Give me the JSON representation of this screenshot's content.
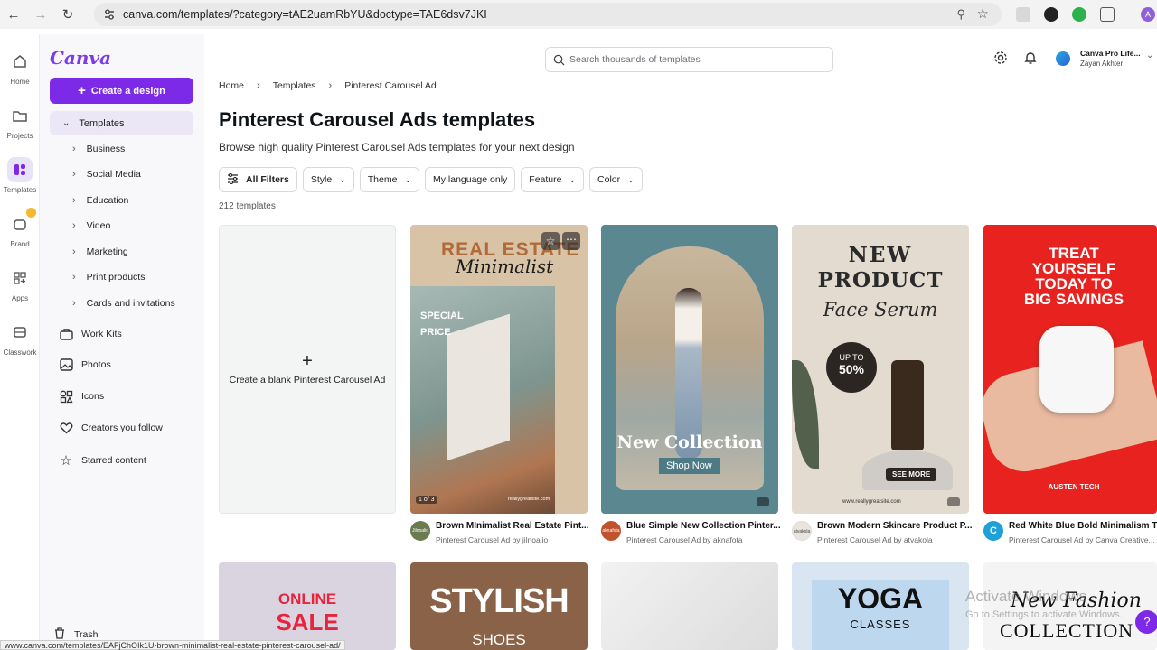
{
  "browser": {
    "url": "canva.com/templates/?category=tAE2uamRbYU&doctype=TAE6dsv7JKI",
    "profile_initial": "A",
    "status_url": "www.canva.com/templates/EAFjChOIk1U-brown-minimalist-real-estate-pinterest-carousel-ad/"
  },
  "rail": [
    {
      "label": "Home"
    },
    {
      "label": "Projects"
    },
    {
      "label": "Templates"
    },
    {
      "label": "Brand"
    },
    {
      "label": "Apps"
    },
    {
      "label": "Classwork"
    }
  ],
  "sidebar": {
    "logo": "Canva",
    "create_label": "Create a design",
    "templates_label": "Templates",
    "sub_items": [
      "Business",
      "Social Media",
      "Education",
      "Video",
      "Marketing",
      "Print products",
      "Cards and invitations"
    ],
    "main_items": [
      "Work Kits",
      "Photos",
      "Icons",
      "Creators you follow",
      "Starred content"
    ],
    "trash_label": "Trash"
  },
  "header": {
    "search_placeholder": "Search thousands of templates",
    "account_name": "Canva Pro Life...",
    "account_user": "Zayan Akhter"
  },
  "breadcrumb": [
    "Home",
    "Templates",
    "Pinterest Carousel Ad"
  ],
  "page": {
    "title": "Pinterest Carousel Ads templates",
    "subtitle": "Browse high quality Pinterest Carousel Ads templates for your next design",
    "count": "212 templates"
  },
  "filters": [
    "All Filters",
    "Style",
    "Theme",
    "My language only",
    "Feature",
    "Color"
  ],
  "blank_card": {
    "label": "Create a blank Pinterest Carousel Ad"
  },
  "templates": [
    {
      "name": "Brown MInimalist Real Estate Pint...",
      "byline": "Pinterest Carousel Ad by jilnoalio",
      "avatar_color": "#6b7a4f",
      "avatar_text": "Jilnoalio",
      "lines": [
        "REAL ESTATE",
        "Minimalist",
        "SPECIAL",
        "PRICE"
      ],
      "pager": "1 of 3",
      "footer_text": "reallygreatsite.com"
    },
    {
      "name": "Blue Simple New Collection Pinter...",
      "byline": "Pinterest Carousel Ad by aknafota",
      "avatar_color": "#c0522d",
      "avatar_text": "aknafota",
      "lines": [
        "New Collection",
        "Shop Now"
      ]
    },
    {
      "name": "Brown Modern Skincare Product P...",
      "byline": "Pinterest Carousel Ad by atvakola",
      "avatar_color": "#e9e4dc",
      "avatar_text": "atvakola",
      "lines": [
        "NEW",
        "PRODUCT",
        "Face Serum",
        "UP TO",
        "50%",
        "SEE MORE"
      ],
      "footer_text": "www.reallygreatsite.com"
    },
    {
      "name": "Red White Blue Bold Minimalism T...",
      "byline": "Pinterest Carousel Ad by Canva Creative...",
      "avatar_color": "#1da1d8",
      "avatar_text": "C",
      "lines": [
        "TREAT",
        "YOURSELF",
        "TODAY TO",
        "BIG SAVINGS",
        "AUSTEN TECH"
      ]
    }
  ],
  "row2": [
    {
      "lines": [
        "ONLINE",
        "SALE"
      ]
    },
    {
      "lines": [
        "STYLISH",
        "SHOES"
      ]
    },
    {
      "lines": []
    },
    {
      "lines": [
        "YOGA",
        "CLASSES"
      ]
    },
    {
      "lines": [
        "New Fashion",
        "COLLECTION"
      ]
    }
  ],
  "watermark": {
    "line1": "Activate Windows",
    "line2": "Go to Settings to activate Windows."
  },
  "colors": {
    "accent": "#7d2ae8",
    "brand": "#7c3aed"
  }
}
